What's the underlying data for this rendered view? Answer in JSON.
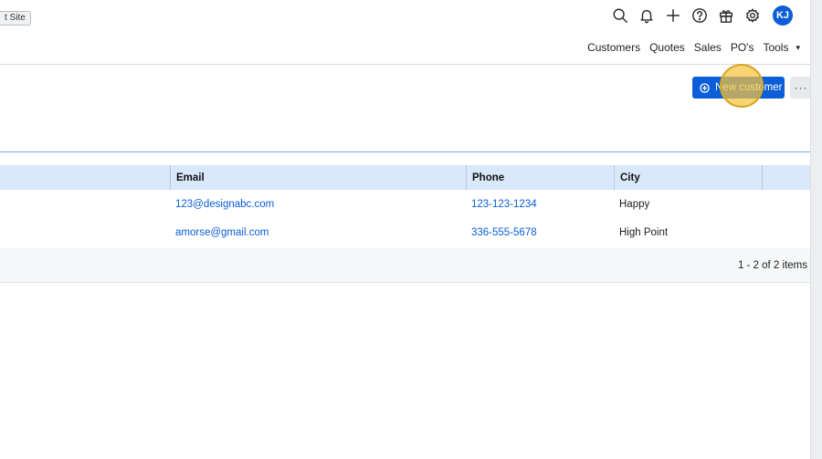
{
  "site_badge": "t Site",
  "user": {
    "initials": "KJ"
  },
  "top_icons": [
    "search-icon",
    "bell-icon",
    "plus-icon",
    "help-icon",
    "gift-icon",
    "gear-icon"
  ],
  "nav": {
    "items": [
      "Customers",
      "Quotes",
      "Sales",
      "PO's",
      "Tools"
    ],
    "caret": "▾"
  },
  "toolbar": {
    "new_label": "New customer",
    "more_label": "···"
  },
  "search": {
    "value": "",
    "placeholder": ""
  },
  "table": {
    "columns": [
      "",
      "Email",
      "Phone",
      "City",
      ""
    ],
    "rows": [
      {
        "email": "123@designabc.com",
        "phone": "123-123-1234",
        "city": "Happy"
      },
      {
        "email": "amorse@gmail.com",
        "phone": "336-555-5678",
        "city": "High Point"
      }
    ],
    "pager": "1 - 2 of 2 items"
  },
  "colors": {
    "accent": "#0b5ed7",
    "header_bg": "#d9e8fb",
    "highlight": "#f5c43c"
  }
}
